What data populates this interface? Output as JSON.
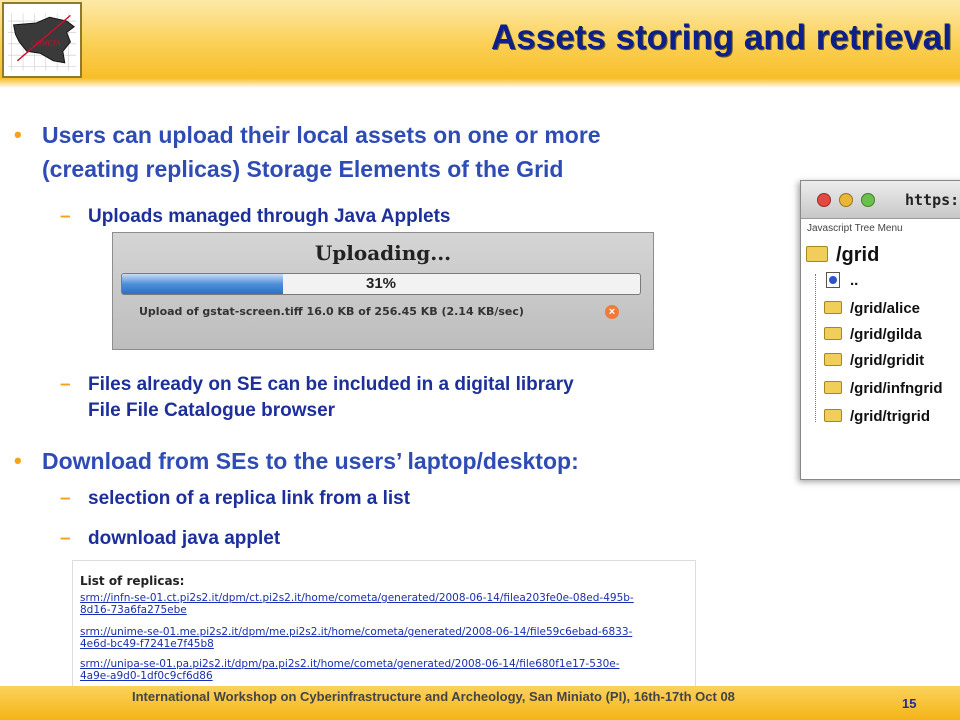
{
  "header": {
    "title": "Assets storing and retrieval",
    "logo_icon": "sicily-grid-logo"
  },
  "bullets": [
    {
      "text_line1": "Users can upload their local assets on one or more",
      "text_line2": "(creating replicas) Storage Elements of the Grid",
      "sub": [
        "Uploads managed through Java Applets"
      ]
    },
    {
      "sub_lines": [
        "Files already on SE can be included in a digital library",
        "File File Catalogue browser"
      ]
    },
    {
      "text_line1": "Download from SEs to the users’ laptop/desktop:",
      "sub": [
        "selection of a replica link from a list",
        "download java applet"
      ]
    }
  ],
  "upload_applet": {
    "title": "Uploading...",
    "percent_label": "31%",
    "progress": 0.31,
    "status": "Upload of gstat-screen.tiff  16.0 KB of 256.45 KB (2.14 KB/sec)",
    "cancel_icon": "cancel-icon"
  },
  "tree_window": {
    "url": "https://",
    "menu_header": "Javascript Tree Menu",
    "root": "/grid",
    "parent": "..",
    "children": [
      "/grid/alice",
      "/grid/gilda",
      "/grid/gridit",
      "/grid/infngrid",
      "/grid/trigrid"
    ]
  },
  "replicas": {
    "header": "List of replicas:",
    "links": [
      "srm://infn-se-01.ct.pi2s2.it/dpm/ct.pi2s2.it/home/cometa/generated/2008-06-14/filea203fe0e-08ed-495b-",
      "8d16-73a6fa275ebe",
      "srm://unime-se-01.me.pi2s2.it/dpm/me.pi2s2.it/home/cometa/generated/2008-06-14/file59c6ebad-6833-",
      "4e6d-bc49-f7241e7f45b8",
      "srm://unipa-se-01.pa.pi2s2.it/dpm/pa.pi2s2.it/home/cometa/generated/2008-06-14/file680f1e17-530e-",
      "4a9e-a9d0-1df0c9cf6d86"
    ]
  },
  "footer": {
    "text": "International Workshop on Cyberinfrastructure and Archeology, San Miniato (PI), 16th-17th Oct 08",
    "page_number": "15"
  }
}
